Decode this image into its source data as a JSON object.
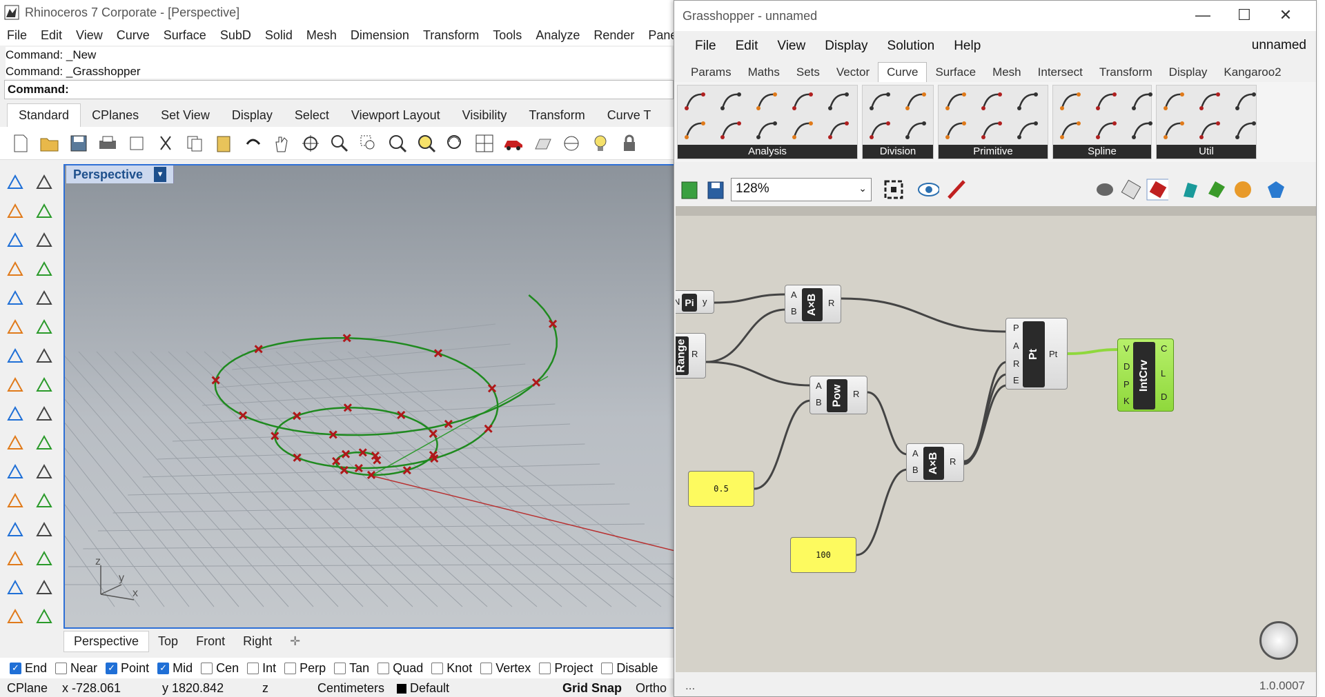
{
  "rhino": {
    "title": "Rhinoceros 7 Corporate - [Perspective]",
    "menu": [
      "File",
      "Edit",
      "View",
      "Curve",
      "Surface",
      "SubD",
      "Solid",
      "Mesh",
      "Dimension",
      "Transform",
      "Tools",
      "Analyze",
      "Render",
      "Pane"
    ],
    "command_history": [
      "Command: _New",
      "Command: _Grasshopper"
    ],
    "command_prompt": "Command:",
    "toolbar_tabs": [
      "Standard",
      "CPlanes",
      "Set View",
      "Display",
      "Select",
      "Viewport Layout",
      "Visibility",
      "Transform",
      "Curve T"
    ],
    "active_toolbar_tab": "Standard",
    "viewport_title": "Perspective",
    "viewport_tabs": [
      "Perspective",
      "Top",
      "Front",
      "Right"
    ],
    "viewport_add": "✛",
    "axis_labels": {
      "z": "z",
      "y": "y",
      "x": "x"
    },
    "osnaps": [
      {
        "label": "End",
        "checked": true
      },
      {
        "label": "Near",
        "checked": false
      },
      {
        "label": "Point",
        "checked": true
      },
      {
        "label": "Mid",
        "checked": true
      },
      {
        "label": "Cen",
        "checked": false
      },
      {
        "label": "Int",
        "checked": false
      },
      {
        "label": "Perp",
        "checked": false
      },
      {
        "label": "Tan",
        "checked": false
      },
      {
        "label": "Quad",
        "checked": false
      },
      {
        "label": "Knot",
        "checked": false
      },
      {
        "label": "Vertex",
        "checked": false
      },
      {
        "label": "Project",
        "checked": false
      },
      {
        "label": "Disable",
        "checked": false
      }
    ],
    "status": {
      "cplane": "CPlane",
      "x": "x -728.061",
      "y": "y 1820.842",
      "z": "z",
      "units": "Centimeters",
      "layer": "Default",
      "grid_snap": "Grid Snap",
      "ortho": "Ortho"
    },
    "colors": {
      "curve": "#1f8a1f",
      "point": "#b0181a",
      "x_axis": "#b83030",
      "y_axis": "#2f9a2f",
      "accent": "#2d6fd6"
    }
  },
  "grasshopper": {
    "title": "Grasshopper - unnamed",
    "document_name": "unnamed",
    "menu": [
      "File",
      "Edit",
      "View",
      "Display",
      "Solution",
      "Help"
    ],
    "tabs": [
      "Params",
      "Maths",
      "Sets",
      "Vector",
      "Curve",
      "Surface",
      "Mesh",
      "Intersect",
      "Transform",
      "Display",
      "Kangaroo2"
    ],
    "active_tab": "Curve",
    "ribbon_groups": [
      "Analysis",
      "Division",
      "Primitive",
      "Spline",
      "Util"
    ],
    "zoom": "128%",
    "components": {
      "pi": {
        "label": "Pi",
        "output": "y",
        "input": "N"
      },
      "mult1": {
        "label": "A×B",
        "inputs": [
          "A",
          "B"
        ],
        "output": "R"
      },
      "range": {
        "label": "Range",
        "output": "R"
      },
      "pow": {
        "label": "Pow",
        "inputs": [
          "A",
          "B"
        ],
        "output": "R"
      },
      "mult2": {
        "label": "A×B",
        "inputs": [
          "A",
          "B"
        ],
        "output": "R"
      },
      "pt": {
        "label": "Pt",
        "inputs": [
          "P",
          "A",
          "R",
          "E"
        ],
        "output": "Pt"
      },
      "intcrv": {
        "label": "IntCrv",
        "inputs": [
          "V",
          "D",
          "P",
          "K"
        ],
        "outputs": [
          "C",
          "L",
          "D"
        ]
      }
    },
    "sliders": {
      "s1": "0.5",
      "s2": "100"
    },
    "version": "1.0.0007",
    "ellipsis": "..."
  }
}
